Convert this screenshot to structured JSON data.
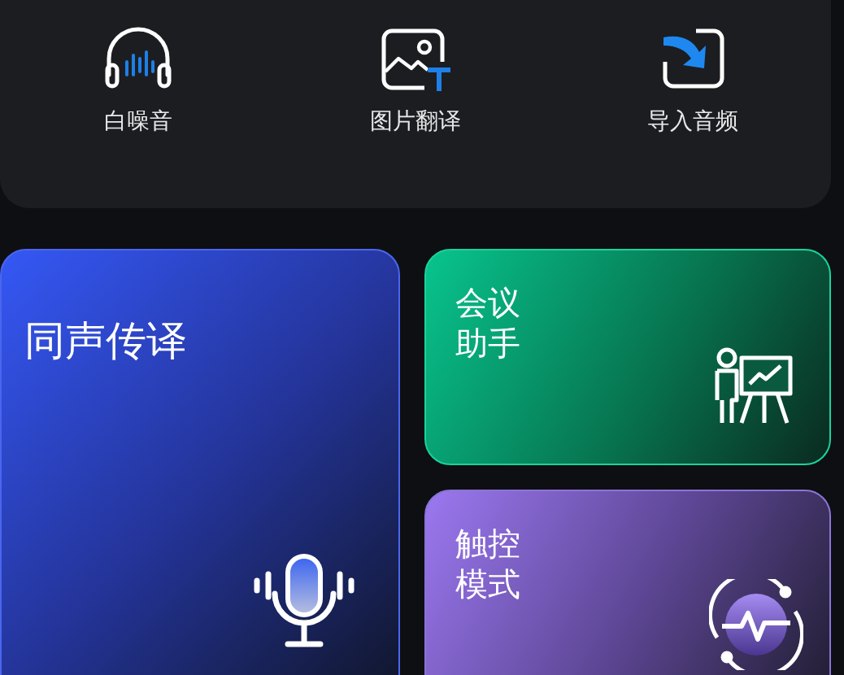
{
  "tools": [
    {
      "kind": "headphones",
      "label": "白噪音"
    },
    {
      "kind": "image-text",
      "label": "图片翻译"
    },
    {
      "kind": "import",
      "label": "导入音频"
    }
  ],
  "cards": [
    {
      "kind": "mic",
      "title_lines": [
        "同声传译"
      ]
    },
    {
      "kind": "presenter",
      "title_lines": [
        "会议",
        "助手"
      ]
    },
    {
      "kind": "touch",
      "title_lines": [
        "触控",
        "模式"
      ]
    }
  ]
}
